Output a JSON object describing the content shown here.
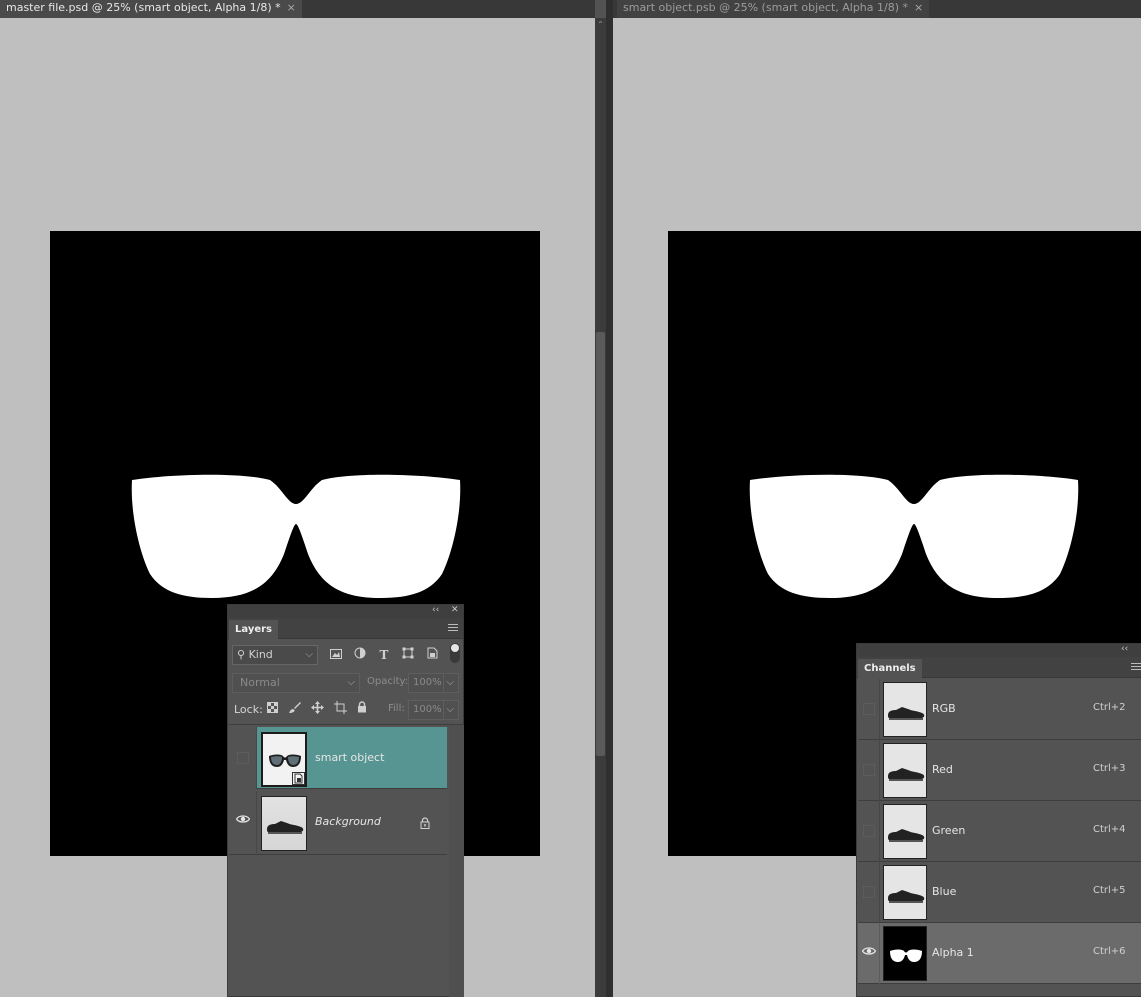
{
  "left_window": {
    "tab_title": "master file.psd @ 25% (smart object, Alpha 1/8) *",
    "close_glyph": "×"
  },
  "right_window": {
    "tab_title": "smart object.psb @ 25% (smart object, Alpha 1/8) *",
    "close_glyph": "×"
  },
  "layers_panel": {
    "collapse_glyph": "‹‹",
    "close_glyph": "✕",
    "tab_label": "Layers",
    "filter_label": "Kind",
    "blend_mode": "Normal",
    "opacity_label": "Opacity:",
    "opacity_value": "100%",
    "lock_label": "Lock:",
    "fill_label": "Fill:",
    "fill_value": "100%",
    "layers": [
      {
        "name": "smart object",
        "visible": false,
        "selected": true,
        "locked": false,
        "thumb_icon": "sunglasses-thumbnail"
      },
      {
        "name": "Background",
        "visible": true,
        "selected": false,
        "locked": true,
        "thumb_icon": "shoe-thumbnail"
      }
    ]
  },
  "channels_panel": {
    "collapse_glyph": "‹‹",
    "tab_label": "Channels",
    "channels": [
      {
        "name": "RGB",
        "shortcut": "Ctrl+2",
        "visible": false,
        "selected": false
      },
      {
        "name": "Red",
        "shortcut": "Ctrl+3",
        "visible": false,
        "selected": false
      },
      {
        "name": "Green",
        "shortcut": "Ctrl+4",
        "visible": false,
        "selected": false
      },
      {
        "name": "Blue",
        "shortcut": "Ctrl+5",
        "visible": false,
        "selected": false
      },
      {
        "name": "Alpha 1",
        "shortcut": "Ctrl+6",
        "visible": true,
        "selected": true
      }
    ]
  },
  "colors": {
    "canvas_gray": "#bfbfbf",
    "selected_layer": "#579593",
    "panel_bg": "#535353"
  }
}
